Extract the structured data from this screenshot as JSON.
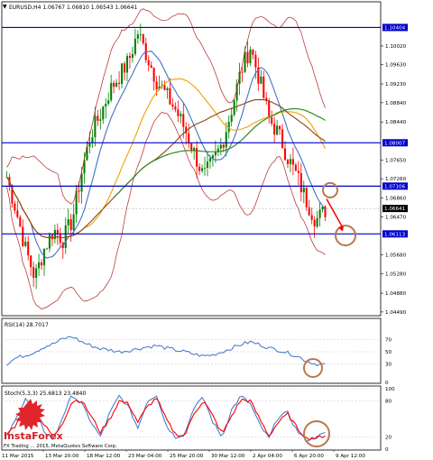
{
  "chart_data": [
    {
      "type": "candlestick",
      "title": "EURUSD,H4  1.06767 1.06810 1.06543 1.06641",
      "ylim": [
        1.0445,
        1.109
      ],
      "yticks": [
        "1.10020",
        "1.09630",
        "1.09230",
        "1.08840",
        "1.08440",
        "1.07650",
        "1.07260",
        "1.06860",
        "1.06470",
        "1.05680",
        "1.05280",
        "1.04880",
        "1.04490"
      ],
      "xticks": [
        "11 Mar 2015",
        "13 Mar 20:00",
        "18 Mar 12:00",
        "23 Mar 04:00",
        "25 Mar 20:00",
        "30 Mar 12:00",
        "2 Apr 04:00",
        "6 Apr 20:00",
        "9 Apr 12:00"
      ],
      "horizontal_levels": [
        {
          "value": "1.10404",
          "price": 1.10404
        },
        {
          "value": "1.08007",
          "price": 1.08007
        },
        {
          "value": "1.07106",
          "price": 1.07106
        },
        {
          "value": "1.06113",
          "price": 1.06113
        }
      ],
      "current_price": {
        "value": "1.06641",
        "price": 1.06641
      },
      "ohlc_anchor_closes": [
        1.073,
        1.066,
        1.058,
        1.052,
        1.058,
        1.062,
        1.06,
        1.064,
        1.074,
        1.082,
        1.086,
        1.091,
        1.094,
        1.097,
        1.103,
        1.098,
        1.093,
        1.09,
        1.087,
        1.083,
        1.078,
        1.073,
        1.076,
        1.08,
        1.087,
        1.095,
        1.1,
        1.093,
        1.085,
        1.082,
        1.077,
        1.073,
        1.068,
        1.064,
        1.066
      ]
    },
    {
      "type": "line",
      "title": "RSI(14) 28.7017",
      "yticks": [
        "70",
        "50",
        "30",
        "0"
      ],
      "ylim": [
        0,
        100
      ],
      "series": [
        {
          "values": [
            30,
            40,
            44,
            50,
            58,
            63,
            71,
            75,
            66,
            60,
            55,
            53,
            50,
            52,
            55,
            58,
            60,
            56,
            53,
            50,
            46,
            43,
            45,
            50,
            56,
            62,
            66,
            62,
            56,
            53,
            48,
            43,
            35,
            30,
            29
          ]
        }
      ]
    },
    {
      "type": "line",
      "title": "Stoch(5,3,3) 25.6813 23.4840",
      "yticks": [
        "100",
        "80",
        "20",
        "0"
      ],
      "ylim": [
        0,
        100
      ],
      "series": [
        {
          "values": [
            20,
            50,
            85,
            60,
            30,
            15,
            55,
            90,
            75,
            45,
            20,
            60,
            88,
            70,
            35,
            80,
            90,
            40,
            20,
            25,
            70,
            85,
            45,
            20,
            65,
            88,
            75,
            40,
            18,
            55,
            60,
            30,
            15,
            20,
            26
          ]
        },
        {
          "values": [
            25,
            40,
            70,
            65,
            40,
            20,
            45,
            80,
            80,
            55,
            28,
            50,
            80,
            75,
            45,
            70,
            85,
            50,
            25,
            22,
            60,
            80,
            55,
            25,
            55,
            82,
            80,
            50,
            22,
            45,
            58,
            35,
            18,
            18,
            23
          ]
        }
      ]
    }
  ],
  "watermark": {
    "brand": "InstaForex",
    "footer": "FX Trading ... 2015, MetaQuotes Software Corp."
  },
  "colors": {
    "level": "#0000cc",
    "bull": "#008000",
    "bear": "#ff0000",
    "bb": "#b22222",
    "ma_fast": "#4472c4",
    "ma_mid": "#f0a000",
    "ma_slow": "#8b4513",
    "ma_green": "#2e8b20",
    "circle": "#b87850",
    "rsi": "#4a7fd0",
    "stoch_main": "#4a7fd0",
    "stoch_signal": "#ff0000"
  }
}
